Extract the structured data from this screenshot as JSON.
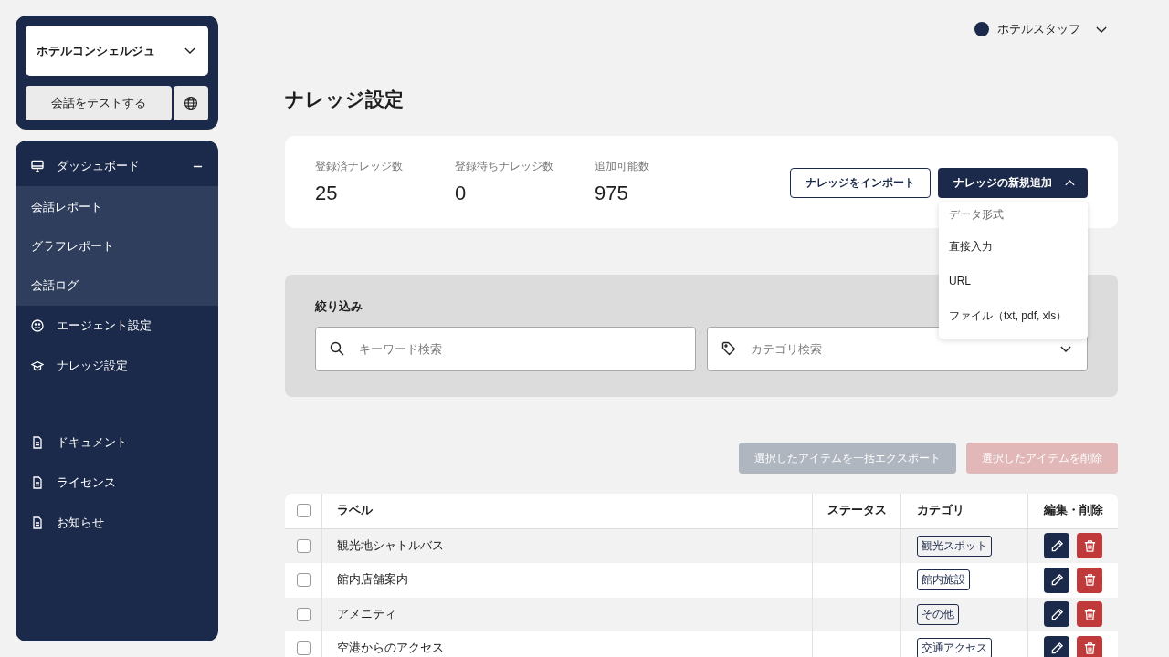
{
  "sidebar": {
    "workspace_select": {
      "value": "ホテルコンシェルジュ"
    },
    "test_button": "会話をテストする",
    "nav": [
      {
        "kind": "group",
        "label": "ダッシュボード",
        "expanded": true,
        "children": [
          {
            "label": "会話レポート"
          },
          {
            "label": "グラフレポート"
          },
          {
            "label": "会話ログ"
          }
        ]
      },
      {
        "kind": "item",
        "label": "エージェント設定"
      },
      {
        "kind": "item",
        "label": "ナレッジ設定"
      }
    ],
    "footer_nav": [
      {
        "label": "ドキュメント"
      },
      {
        "label": "ライセンス"
      },
      {
        "label": "お知らせ"
      }
    ]
  },
  "user_menu": {
    "name": "ホテルスタッフ"
  },
  "page_title": "ナレッジ設定",
  "stats": [
    {
      "label": "登録済ナレッジ数",
      "value": "25"
    },
    {
      "label": "登録待ちナレッジ数",
      "value": "0"
    },
    {
      "label": "追加可能数",
      "value": "975"
    }
  ],
  "import_button": "ナレッジをインポート",
  "add_button": {
    "label": "ナレッジの新規追加",
    "expanded": true,
    "menu": {
      "heading": "データ形式",
      "items": [
        "直接入力",
        "URL",
        "ファイル（txt, pdf, xls）"
      ]
    }
  },
  "filter": {
    "title": "絞り込み",
    "keyword_field": {
      "placeholder": "キーワード検索"
    },
    "category_field": {
      "placeholder": "カテゴリ検索"
    }
  },
  "bulk_actions": [
    {
      "kind": "export",
      "label": "選択したアイテムを一括エクスポート",
      "disabled": true
    },
    {
      "kind": "delete",
      "label": "選択したアイテムを削除",
      "disabled": true
    }
  ],
  "table": {
    "select_all": {
      "checked": false
    },
    "columns": [
      "ラベル",
      "ステータス",
      "カテゴリ",
      "編集・削除"
    ],
    "rows": [
      {
        "checked": false,
        "label": "観光地シャトルバス",
        "category": "観光スポット"
      },
      {
        "checked": false,
        "label": "館内店舗案内",
        "category": "館内施設"
      },
      {
        "checked": false,
        "label": "アメニティ",
        "category": "その他"
      },
      {
        "checked": false,
        "label": "空港からのアクセス",
        "category": "交通アクセス"
      }
    ]
  }
}
